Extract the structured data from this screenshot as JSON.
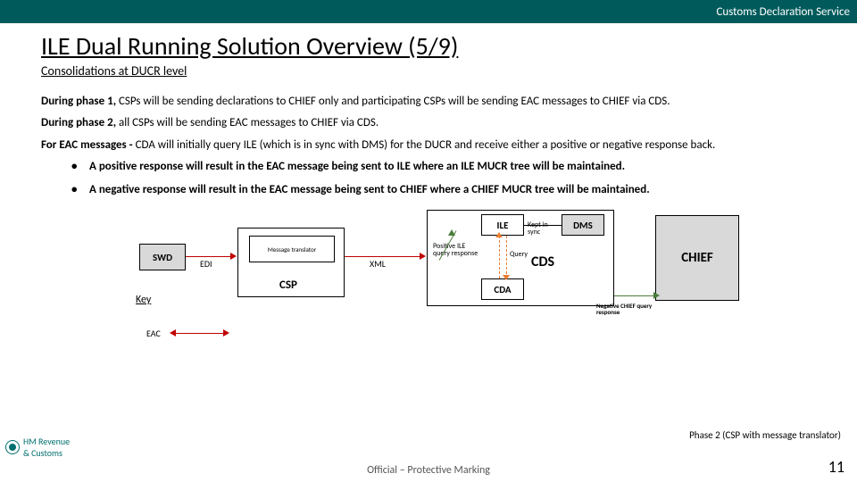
{
  "header": {
    "service": "Customs Declaration Service"
  },
  "title": "ILE Dual Running Solution Overview (5/9)",
  "subtitle": "Consolidations at DUCR level",
  "paragraphs": {
    "p1_prefix": "During phase 1,",
    "p1_rest": " CSPs will be sending declarations to CHIEF only and participating CSPs will be sending EAC messages to CHIEF via CDS.",
    "p2_prefix": "During phase 2,",
    "p2_rest": " all CSPs will be sending EAC messages to CHIEF via CDS.",
    "p3_prefix": "For EAC messages -",
    "p3_rest": " CDA will initially query ILE (which is in sync with DMS) for the DUCR and receive either a positive or negative response back."
  },
  "bullets": {
    "b1": "A positive response will result in the EAC message being sent to ILE where an ILE MUCR tree will be maintained.",
    "b2": "A negative response will result in the EAC message being sent to CHIEF where a CHIEF MUCR tree will be maintained."
  },
  "diagram": {
    "swd": "SWD",
    "edi": "EDI",
    "msg_translator": "Message translator",
    "csp": "CSP",
    "xml": "XML",
    "ile": "ILE",
    "pos_resp": "Positive ILE query response",
    "query": "Query",
    "kept_in_sync": "Kept in sync",
    "cds": "CDS",
    "cda": "CDA",
    "dms": "DMS",
    "chief": "CHIEF",
    "neg_resp": "Negative CHIEF query response",
    "key": "Key",
    "eac": "EAC"
  },
  "footer": {
    "logo_line1": "HM Revenue",
    "logo_line2": "& Customs",
    "phase_note": "Phase 2 (CSP with message translator)",
    "marking": "Official – Protective Marking",
    "page": "11"
  }
}
